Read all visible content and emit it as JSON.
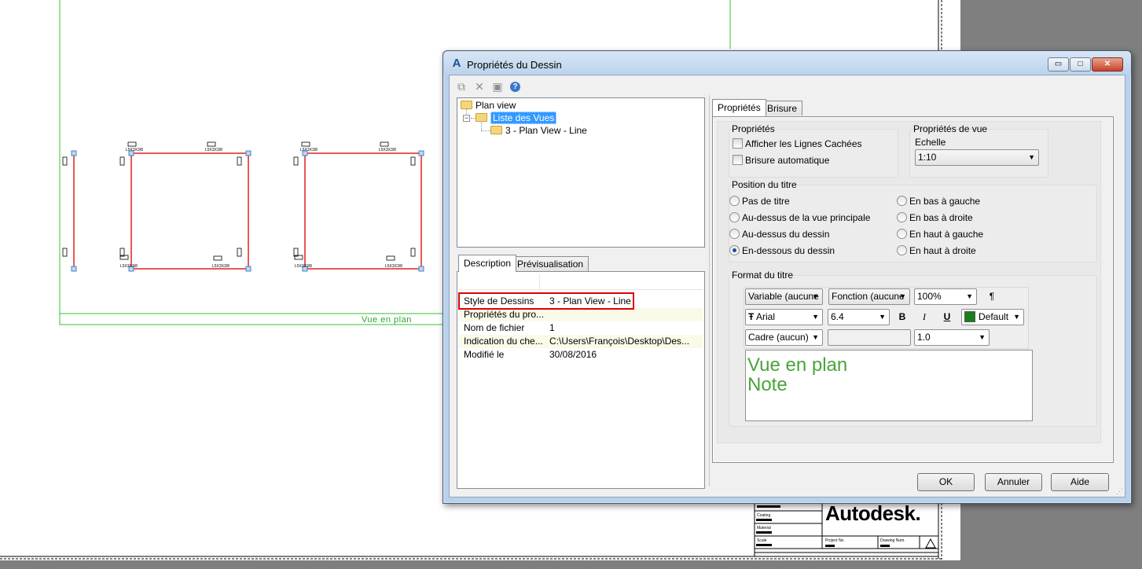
{
  "canvas": {
    "view_label": "Vue en plan",
    "logo_text": "Autodesk.",
    "titleblock": {
      "coating": "Coating",
      "material": "Material",
      "scale": "Scale",
      "project_no": "Project No.",
      "drawing_num": "Drawing Num."
    },
    "part_labels": [
      "L5X3X3/8",
      "L5X3X3/8",
      "L5X3X3/8",
      "L5X3X3/8"
    ],
    "colors": {
      "frame_green": "#2fc42f",
      "member_red": "#e02020",
      "grip_blue": "#5b93c7",
      "background_gray": "#7f7f7f"
    }
  },
  "dialog": {
    "title": "Propriétés du Dessin",
    "window_buttons": {
      "minimize": "▭",
      "maximize": "□",
      "close": "✕"
    },
    "toolbar": {
      "copy_icon": "copy-icon",
      "delete_icon": "delete-icon",
      "save_icon": "save-icon",
      "help_icon": "help-icon",
      "help_glyph": "?"
    },
    "tree": {
      "root": "Plan view",
      "child": "Liste des Vues",
      "grandchild": "3 - Plan View - Line",
      "toggle": "−"
    },
    "left_tabs": {
      "description": "Description",
      "preview": "Prévisualisation"
    },
    "description_rows": [
      {
        "key": "Style de Dessins",
        "value": "3 - Plan View - Line"
      },
      {
        "key": "Propriétés du pro...",
        "value": ""
      },
      {
        "key": "Nom de fichier",
        "value": "1"
      },
      {
        "key": "Indication du che...",
        "value": "C:\\Users\\François\\Desktop\\Des..."
      },
      {
        "key": "Modifié le",
        "value": "30/08/2016"
      }
    ],
    "right_tabs": {
      "properties": "Propriétés",
      "break": "Brisure"
    },
    "proprietes": {
      "title": "Propriétés",
      "hidden_lines": "Afficher les Lignes Cachées",
      "auto_break": "Brisure automatique"
    },
    "view_properties": {
      "title": "Propriétés de vue",
      "scale_label": "Echelle",
      "scale_value": "1:10"
    },
    "title_position": {
      "title": "Position du titre",
      "options_left": [
        "Pas de titre",
        "Au-dessus de la vue principale",
        "Au-dessus du dessin",
        "En-dessous du dessin"
      ],
      "options_right": [
        "En bas à gauche",
        "En bas à droite",
        "En haut à gauche",
        "En haut à droite"
      ],
      "selected": "En-dessous du dessin"
    },
    "title_format": {
      "title": "Format du titre",
      "variable": "Variable (aucune",
      "function": "Fonction (aucune",
      "zoom": "100%",
      "paragraph_glyph": "¶",
      "font_glyph": "Ŧ",
      "font": "Arial",
      "size": "6.4",
      "bold": "B",
      "italic": "I",
      "underline": "U",
      "color": "Default",
      "color_hex": "#1a7f1a",
      "frame": "Cadre (aucun)",
      "frame_value": "",
      "spacing": "1.0",
      "text_line1": "Vue en plan",
      "text_line2": "Note",
      "text_color": "#4aa33a"
    },
    "buttons": {
      "ok": "OK",
      "cancel": "Annuler",
      "help": "Aide"
    },
    "dropdown_arrow": "▼"
  }
}
